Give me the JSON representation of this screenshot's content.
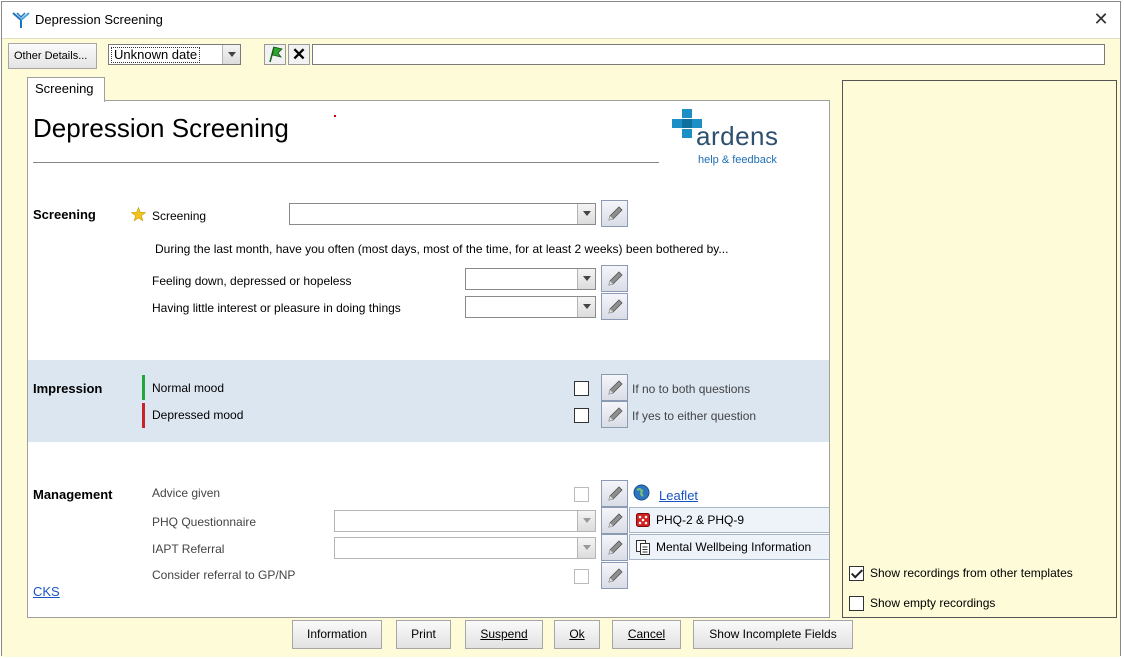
{
  "window": {
    "title": "Depression Screening",
    "close_icon": "close-icon"
  },
  "toolbar": {
    "other_details_label": "Other Details...",
    "date_value": "Unknown date",
    "comment_value": ""
  },
  "tabs": [
    {
      "label": "Screening"
    }
  ],
  "form": {
    "title": "Depression Screening",
    "logo": {
      "name": "ardens",
      "help_link": "help & feedback"
    },
    "screening": {
      "section_label": "Screening",
      "screening_label": "Screening",
      "screening_value": "",
      "question": "During the last month, have you often (most days, most of the time, for at least 2 weeks) been bothered by...",
      "q1_label": "Feeling down, depressed or hopeless",
      "q1_value": "",
      "q2_label": "Having little interest or pleasure in doing things",
      "q2_value": ""
    },
    "impression": {
      "section_label": "Impression",
      "normal_label": "Normal mood",
      "normal_hint": "If no to both questions",
      "normal_color": "#22a83a",
      "depressed_label": "Depressed mood",
      "depressed_hint": "If yes to either question",
      "depressed_color": "#c8222a"
    },
    "management": {
      "section_label": "Management",
      "advice_label": "Advice given",
      "leaflet_link": "Leaflet",
      "phq_label": "PHQ Questionnaire",
      "phq_value": "",
      "phq_link": "PHQ-2 & PHQ-9",
      "iapt_label": "IAPT Referral",
      "iapt_value": "",
      "iapt_link": "Mental Wellbeing Information",
      "gp_label": "Consider referral to GP/NP",
      "cks_link": "CKS"
    }
  },
  "sidebar": {
    "show_other_templates": "Show recordings from other templates",
    "show_other_templates_checked": true,
    "show_empty": "Show empty recordings",
    "show_empty_checked": false
  },
  "buttons": {
    "information": "Information",
    "print": "Print",
    "suspend": "Suspend",
    "ok": "Ok",
    "cancel": "Cancel",
    "show_incomplete": "Show Incomplete Fields"
  }
}
